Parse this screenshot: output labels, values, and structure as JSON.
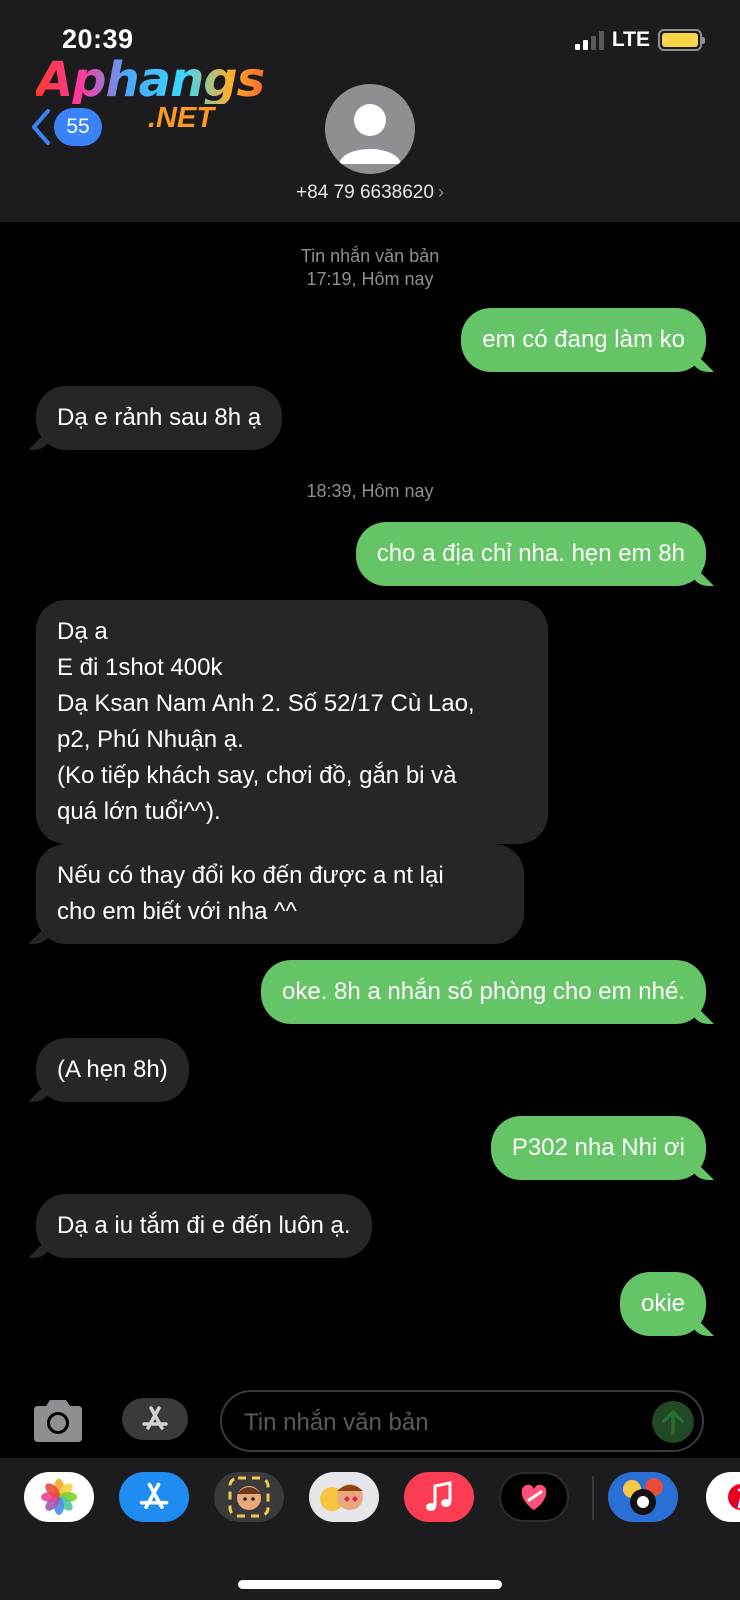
{
  "status_bar": {
    "time": "20:39",
    "network": "LTE"
  },
  "logo": {
    "main": "Aphangs",
    "sub": ".NET"
  },
  "header": {
    "back_count": "55",
    "contact": "+84 79 6638620"
  },
  "timestamps": [
    {
      "label": "Tin nhắn văn bản",
      "time": "17:19, Hôm nay"
    },
    {
      "time": "18:39, Hôm nay"
    }
  ],
  "messages": [
    {
      "dir": "out",
      "text": "em có đang làm ko"
    },
    {
      "dir": "in",
      "text": "Dạ e rảnh sau 8h ạ"
    },
    {
      "dir": "out",
      "text": "cho a địa chỉ nha. hẹn em 8h"
    },
    {
      "dir": "in",
      "lines": [
        "Dạ a",
        "E đi 1shot 400k",
        "Dạ Ksan Nam Anh 2. Số 52/17 Cù Lao,",
        "p2, Phú Nhuận ạ.",
        "(Ko tiếp khách say, chơi đồ, gắn bi và",
        "quá lớn tuổi^^)."
      ]
    },
    {
      "dir": "in",
      "lines": [
        "Nếu có thay đổi ko đến được a nt lại",
        "cho em biết với nha ^^"
      ]
    },
    {
      "dir": "out",
      "text": "oke. 8h a nhắn số phòng cho em nhé."
    },
    {
      "dir": "in",
      "text": "(A hẹn 8h)"
    },
    {
      "dir": "out",
      "text": "P302 nha Nhi ơi"
    },
    {
      "dir": "in",
      "text": "Dạ a iu tắm đi e đến luôn ạ."
    },
    {
      "dir": "out",
      "text": "okie"
    }
  ],
  "composer": {
    "placeholder": "Tin nhắn văn bản"
  },
  "app_strip": [
    "photos-icon",
    "app-store-icon",
    "memoji-icon",
    "animoji-icon",
    "music-icon",
    "digital-touch-icon",
    "8-ball-pool-icon",
    "pinterest-icon"
  ],
  "colors": {
    "outgoing": "#65c466",
    "incoming": "#262628",
    "badge": "#3a82f7"
  }
}
